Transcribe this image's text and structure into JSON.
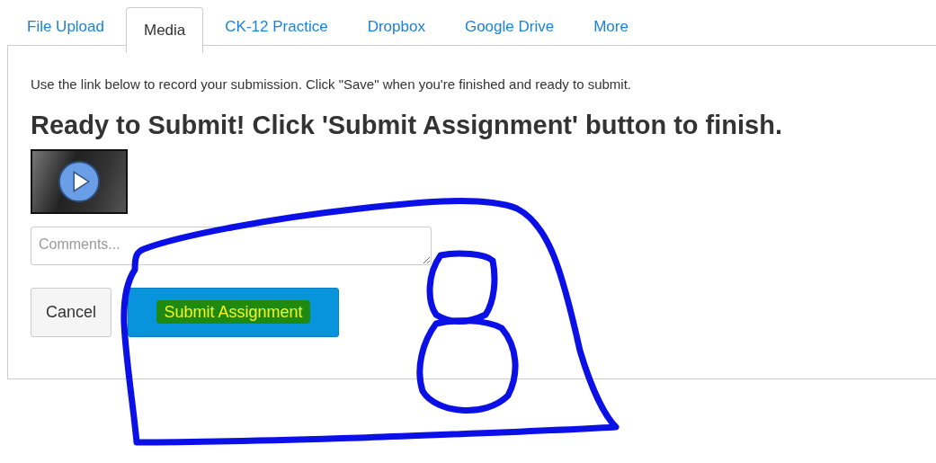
{
  "tabs": [
    {
      "label": "File Upload",
      "selected": false
    },
    {
      "label": "Media",
      "selected": true
    },
    {
      "label": "CK-12 Practice",
      "selected": false
    },
    {
      "label": "Dropbox",
      "selected": false
    },
    {
      "label": "Google Drive",
      "selected": false
    },
    {
      "label": "More",
      "selected": false
    }
  ],
  "instructions": "Use the link below to record your submission. Click \"Save\" when you're finished and ready to submit.",
  "heading": "Ready to Submit! Click 'Submit Assignment' button to finish.",
  "comments": {
    "placeholder": "Comments..."
  },
  "buttons": [
    {
      "label": "Cancel",
      "kind": "secondary"
    },
    {
      "label": "Submit Assignment",
      "kind": "primary"
    }
  ]
}
